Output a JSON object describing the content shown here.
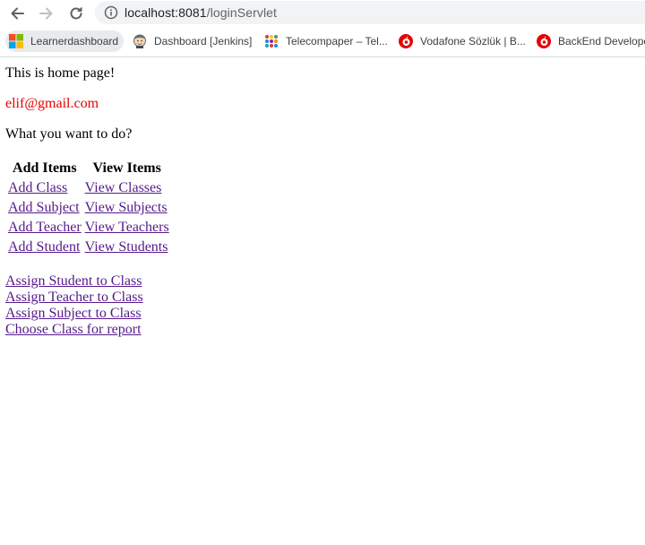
{
  "browser": {
    "url_host": "localhost:8081",
    "url_path": "/loginServlet",
    "bookmarks": [
      {
        "label": "Learnerdashboard",
        "icon": "microsoft-icon"
      },
      {
        "label": "Dashboard [Jenkins]",
        "icon": "jenkins-icon"
      },
      {
        "label": "Telecompaper – Tel...",
        "icon": "telecompaper-icon"
      },
      {
        "label": "Vodafone Sözlük | B...",
        "icon": "vodafone-icon"
      },
      {
        "label": "BackEnd Develope",
        "icon": "vodafone-icon"
      }
    ]
  },
  "page": {
    "greeting": "This is home page!",
    "email": "elif@gmail.com",
    "prompt": "What you want to do?",
    "table": {
      "headers": [
        "Add Items",
        "View Items"
      ],
      "rows": [
        [
          "Add Class",
          "View Classes"
        ],
        [
          "Add Subject",
          "View Subjects"
        ],
        [
          "Add Teacher",
          "View Teachers"
        ],
        [
          "Add Student",
          "View Students"
        ]
      ]
    },
    "links": [
      "Assign Student to Class",
      "Assign Teacher to Class",
      "Assign Subject to Class",
      "Choose Class for report"
    ]
  },
  "colors": {
    "email": "#e60000",
    "link": "#551a8b",
    "omnibox_bg": "#f1f3f4"
  }
}
